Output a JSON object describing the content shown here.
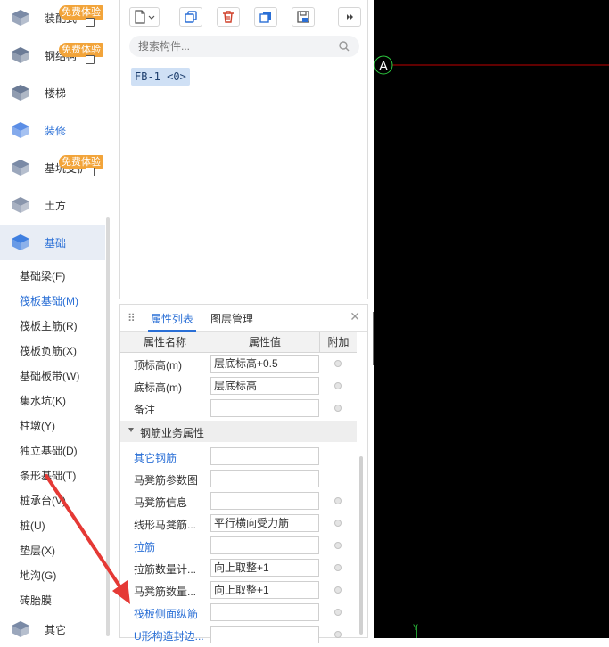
{
  "nav": {
    "categories": [
      {
        "label": "装配式",
        "badge": "免费体验",
        "icon": "prefab-icon"
      },
      {
        "label": "钢结构",
        "badge": "免费体验",
        "icon": "steel-beam-icon"
      },
      {
        "label": "楼梯",
        "badge": "",
        "icon": "stairs-icon"
      },
      {
        "label": "装修",
        "badge": "",
        "icon": "decoration-icon"
      },
      {
        "label": "基坑支护",
        "badge": "免费体验",
        "icon": "pit-icon"
      },
      {
        "label": "土方",
        "badge": "",
        "icon": "earthwork-icon"
      },
      {
        "label": "基础",
        "badge": "",
        "icon": "foundation-icon"
      },
      {
        "label": "其它",
        "badge": "",
        "icon": "other-icon"
      }
    ],
    "subitems": [
      "基础梁(F)",
      "筏板基础(M)",
      "筏板主筋(R)",
      "筏板负筋(X)",
      "基础板带(W)",
      "集水坑(K)",
      "柱墩(Y)",
      "独立基础(D)",
      "条形基础(T)",
      "桩承台(V)",
      "桩(U)",
      "垫层(X)",
      "地沟(G)",
      "砖胎膜"
    ],
    "selected_subitem": "筏板基础(M)"
  },
  "toolbar": {
    "icons": [
      "new-icon",
      "copy-icon",
      "delete-icon",
      "layer-copy-icon",
      "save-icon",
      "more-icon"
    ]
  },
  "search": {
    "placeholder": "搜索构件..."
  },
  "component_item": "FB-1 <0>",
  "props": {
    "tabs": [
      "属性列表",
      "图层管理"
    ],
    "headers": {
      "name": "属性名称",
      "value": "属性值",
      "extra": "附加"
    },
    "rows": [
      {
        "name": "顶标高(m)",
        "value": "层底标高+0.5",
        "blue": false,
        "dot": true
      },
      {
        "name": "底标高(m)",
        "value": "层底标高",
        "blue": false,
        "dot": true
      },
      {
        "name": "备注",
        "value": "",
        "blue": false,
        "dot": true
      }
    ],
    "group": "钢筋业务属性",
    "group_rows": [
      {
        "name": "其它钢筋",
        "value": "",
        "blue": true,
        "dot": false
      },
      {
        "name": "马凳筋参数图",
        "value": "",
        "blue": false,
        "dot": false
      },
      {
        "name": "马凳筋信息",
        "value": "",
        "blue": false,
        "dot": true
      },
      {
        "name": "线形马凳筋...",
        "value": "平行横向受力筋",
        "blue": false,
        "dot": true
      },
      {
        "name": "拉筋",
        "value": "",
        "blue": true,
        "dot": true
      },
      {
        "name": "拉筋数量计...",
        "value": "向上取整+1",
        "blue": false,
        "dot": true
      },
      {
        "name": "马凳筋数量...",
        "value": "向上取整+1",
        "blue": false,
        "dot": true
      },
      {
        "name": "筏板侧面纵筋",
        "value": "",
        "blue": true,
        "dot": true
      },
      {
        "name": "U形构造封边...",
        "value": "",
        "blue": true,
        "dot": true
      }
    ]
  },
  "canvas": {
    "axis_label": "A",
    "y_label": "Y",
    "line_color": "#c00000",
    "axis_color": "#2ecc40"
  },
  "colors": {
    "accent": "#2a6fd6",
    "badge": "#f2a43a",
    "arrow": "#e53935"
  }
}
